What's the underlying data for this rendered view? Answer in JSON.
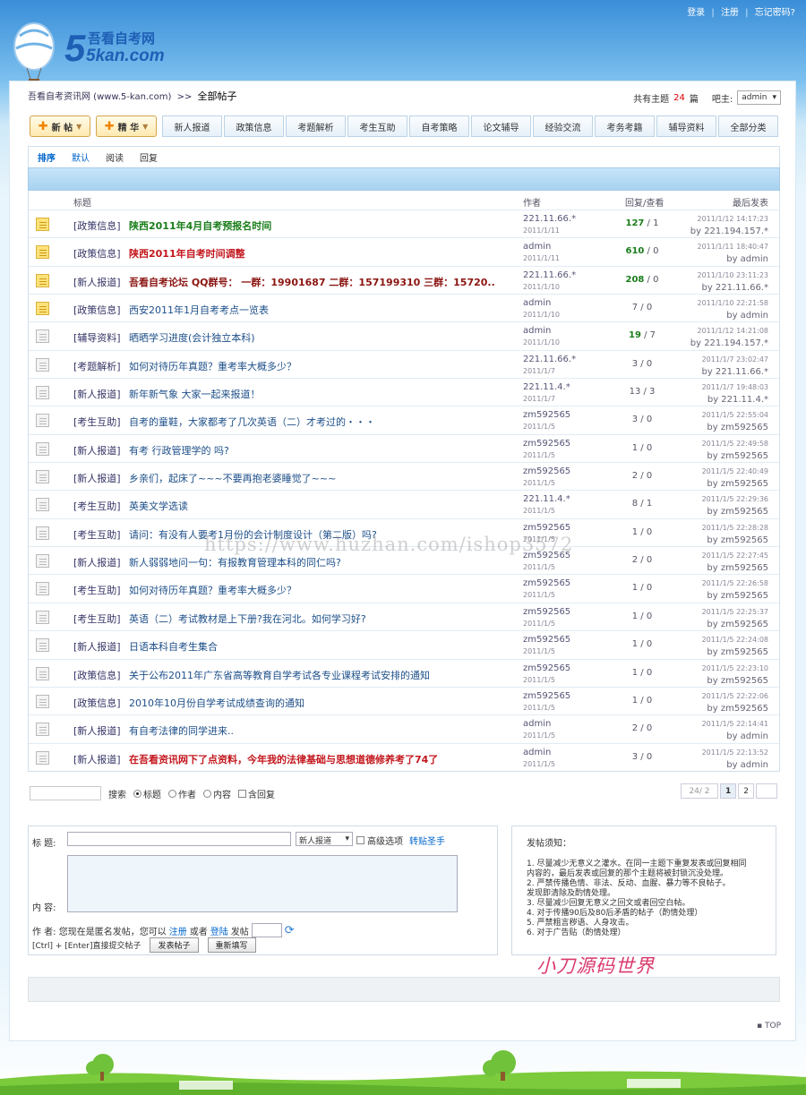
{
  "toplinks": {
    "login": "登录",
    "register": "注册",
    "forgot": "忘记密码?"
  },
  "logo": {
    "top": "吾看自考网",
    "bottom": "5kan.com"
  },
  "breadcrumb": {
    "home": "吾看自考资讯网 (www.5-kan.com)",
    "sep": ">>",
    "current": "全部帖子"
  },
  "topic_info": {
    "prefix": "共有主题",
    "count": "24",
    "suffix": "篇",
    "master_label": "吧主:",
    "master_value": "admin"
  },
  "buttons": {
    "new_post": "新 帖",
    "featured": "精 华"
  },
  "nav_tabs": [
    "新人报道",
    "政策信息",
    "考题解析",
    "考生互助",
    "自考策略",
    "论文辅导",
    "经验交流",
    "考务考籍",
    "辅导资料",
    "全部分类"
  ],
  "sort": {
    "label": "排序",
    "options": [
      "默认",
      "阅读",
      "回复"
    ]
  },
  "columns": {
    "title": "标题",
    "author": "作者",
    "replies": "回复/查看",
    "last": "最后发表"
  },
  "threads": [
    {
      "hot": true,
      "cat": "[政策信息]",
      "title": "陕西2011年4月自考预报名时间",
      "style": "green",
      "author": "221.11.66.*",
      "date": "2011/1/11",
      "replies": "127",
      "views": "1",
      "last_time": "2011/1/12 14:17:23",
      "last_by": "by 221.194.157.*"
    },
    {
      "hot": true,
      "cat": "[政策信息]",
      "title": "陕西2011年自考时间调整",
      "style": "red",
      "author": "admin",
      "date": "2011/1/11",
      "replies": "610",
      "views": "0",
      "last_time": "2011/1/11 18:40:47",
      "last_by": "by admin"
    },
    {
      "hot": true,
      "cat": "[新人报道]",
      "title": "吾看自考论坛 QQ群号： 一群：19901687 二群：157199310 三群：15720..",
      "style": "darkred",
      "author": "221.11.66.*",
      "date": "2011/1/10",
      "replies": "208",
      "views": "0",
      "last_time": "2011/1/10 23:11:23",
      "last_by": "by 221.11.66.*"
    },
    {
      "hot": true,
      "cat": "[政策信息]",
      "title": "西安2011年1月自考考点一览表",
      "style": "normal",
      "author": "admin",
      "date": "2011/1/10",
      "replies": "7",
      "views": "0",
      "last_time": "2011/1/10 22:21:58",
      "last_by": "by admin"
    },
    {
      "hot": false,
      "cat": "[辅导资料]",
      "title": "晒晒学习进度(会计独立本科)",
      "style": "normal",
      "author": "admin",
      "date": "2011/1/10",
      "replies": "19",
      "views": "7",
      "last_time": "2011/1/12 14:21:08",
      "last_by": "by 221.194.157.*"
    },
    {
      "hot": false,
      "cat": "[考题解析]",
      "title": "如何对待历年真题？重考率大概多少？",
      "style": "normal",
      "author": "221.11.66.*",
      "date": "2011/1/7",
      "replies": "3",
      "views": "0",
      "last_time": "2011/1/7 23:02:47",
      "last_by": "by 221.11.66.*"
    },
    {
      "hot": false,
      "cat": "[新人报道]",
      "title": "新年新气象 大家一起来报道！",
      "style": "normal",
      "author": "221.11.4.*",
      "date": "2011/1/7",
      "replies": "13",
      "views": "3",
      "last_time": "2011/1/7 19:48:03",
      "last_by": "by 221.11.4.*"
    },
    {
      "hot": false,
      "cat": "[考生互助]",
      "title": "自考的童鞋，大家都考了几次英语（二）才考过的・・・",
      "style": "normal",
      "author": "zm592565",
      "date": "2011/1/5",
      "replies": "3",
      "views": "0",
      "last_time": "2011/1/5 22:55:04",
      "last_by": "by zm592565"
    },
    {
      "hot": false,
      "cat": "[新人报道]",
      "title": "有考 行政管理学的 吗?",
      "style": "normal",
      "author": "zm592565",
      "date": "2011/1/5",
      "replies": "1",
      "views": "0",
      "last_time": "2011/1/5 22:49:58",
      "last_by": "by zm592565"
    },
    {
      "hot": false,
      "cat": "[新人报道]",
      "title": "乡亲们，起床了~~~不要再抱老婆睡觉了~~~",
      "style": "normal",
      "author": "zm592565",
      "date": "2011/1/5",
      "replies": "2",
      "views": "0",
      "last_time": "2011/1/5 22:40:49",
      "last_by": "by zm592565"
    },
    {
      "hot": false,
      "cat": "[考生互助]",
      "title": "英美文学选读",
      "style": "normal",
      "author": "221.11.4.*",
      "date": "2011/1/5",
      "replies": "8",
      "views": "1",
      "last_time": "2011/1/5 22:29:36",
      "last_by": "by zm592565"
    },
    {
      "hot": false,
      "cat": "[考生互助]",
      "title": "请问：有没有人要考1月份的会计制度设计（第二版）吗?",
      "style": "normal",
      "author": "zm592565",
      "date": "2011/1/5",
      "replies": "1",
      "views": "0",
      "last_time": "2011/1/5 22:28:28",
      "last_by": "by zm592565"
    },
    {
      "hot": false,
      "cat": "[新人报道]",
      "title": "新人弱弱地问一句：有报教育管理本科的同仁吗?",
      "style": "normal",
      "author": "zm592565",
      "date": "2011/1/5",
      "replies": "2",
      "views": "0",
      "last_time": "2011/1/5 22:27:45",
      "last_by": "by zm592565"
    },
    {
      "hot": false,
      "cat": "[考生互助]",
      "title": "如何对待历年真题？重考率大概多少？",
      "style": "normal",
      "author": "zm592565",
      "date": "2011/1/5",
      "replies": "1",
      "views": "0",
      "last_time": "2011/1/5 22:26:58",
      "last_by": "by zm592565"
    },
    {
      "hot": false,
      "cat": "[考生互助]",
      "title": "英语（二）考试教材是上下册?我在河北。如何学习好?",
      "style": "normal",
      "author": "zm592565",
      "date": "2011/1/5",
      "replies": "1",
      "views": "0",
      "last_time": "2011/1/5 22:25:37",
      "last_by": "by zm592565"
    },
    {
      "hot": false,
      "cat": "[新人报道]",
      "title": "日语本科自考生集合",
      "style": "normal",
      "author": "zm592565",
      "date": "2011/1/5",
      "replies": "1",
      "views": "0",
      "last_time": "2011/1/5 22:24:08",
      "last_by": "by zm592565"
    },
    {
      "hot": false,
      "cat": "[政策信息]",
      "title": "关于公布2011年广东省高等教育自学考试各专业课程考试安排的通知",
      "style": "normal",
      "author": "zm592565",
      "date": "2011/1/5",
      "replies": "1",
      "views": "0",
      "last_time": "2011/1/5 22:23:10",
      "last_by": "by zm592565"
    },
    {
      "hot": false,
      "cat": "[政策信息]",
      "title": "2010年10月份自学考试成绩查询的通知",
      "style": "normal",
      "author": "zm592565",
      "date": "2011/1/5",
      "replies": "1",
      "views": "0",
      "last_time": "2011/1/5 22:22:06",
      "last_by": "by zm592565"
    },
    {
      "hot": false,
      "cat": "[新人报道]",
      "title": "有自考法律的同学进来..",
      "style": "normal",
      "author": "admin",
      "date": "2011/1/5",
      "replies": "2",
      "views": "0",
      "last_time": "2011/1/5 22:14:41",
      "last_by": "by admin"
    },
    {
      "hot": false,
      "cat": "[新人报道]",
      "title": "在吾看资讯网下了点资料，今年我的法律基础与思想道德修养考了74了",
      "style": "red",
      "author": "admin",
      "date": "2011/1/5",
      "replies": "3",
      "views": "0",
      "last_time": "2011/1/5 22:13:52",
      "last_by": "by admin"
    }
  ],
  "search": {
    "button": "搜索",
    "opt_title": "标题",
    "opt_author": "作者",
    "opt_content": "内容",
    "opt_reply": "含回复"
  },
  "pager": {
    "count": "24/ 2",
    "p1": "1",
    "p2": "2"
  },
  "post_form": {
    "title_label": "标 题:",
    "category": "新人报道",
    "advanced": "高级选项",
    "transfer": "转贴圣手",
    "content_label": "内 容:",
    "author_prefix": "作 者: 您现在是匿名发帖，您可以",
    "register_link": "注册",
    "or": "或者",
    "login_link": "登陆",
    "author_suffix": "发帖",
    "hint": "[Ctrl] + [Enter]直接提交帖子",
    "submit": "发表帖子",
    "reset": "重新填写"
  },
  "notice": {
    "title": "发帖须知：",
    "items": [
      "1. 尽量减少无意义之灌水。在同一主题下重复发表或回复相同",
      "内容的，最后发表或回复的那个主题将被封锁沉没处理。",
      "2. 严禁传播色情、非法、反动、血腥、暴力等不良帖子。",
      "发现即清除及酌情处理。",
      "3. 尽量减少回复无意义之回文或者回空白帖。",
      "4. 对于传播90后及80后矛盾的帖子（酌情处理）",
      "5. 严禁粗言秽语、人身攻击。",
      "6. 对于广告贴（酌情处理）"
    ]
  },
  "watermark": "https://www.huzhan.com/ishop3572",
  "watermark2": "小刀源码世界",
  "totop": "TOP"
}
